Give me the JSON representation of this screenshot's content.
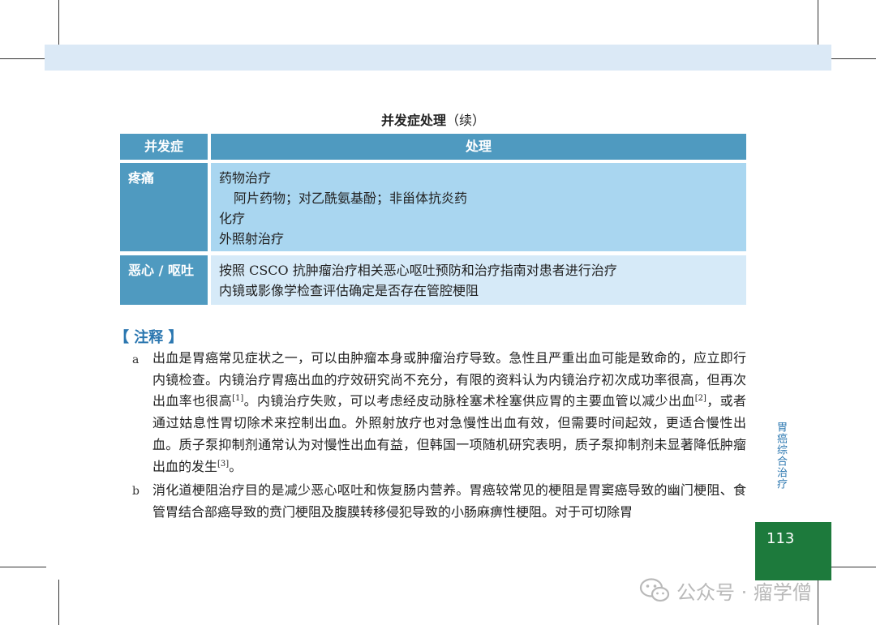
{
  "table": {
    "caption": "并发症处理",
    "caption_suffix": "（续）",
    "headers": {
      "complication": "并发症",
      "treatment": "处理"
    },
    "rows": [
      {
        "label": "疼痛",
        "lines": [
          "药物治疗",
          "阿片药物；对乙酰氨基酚；非甾体抗炎药",
          "化疗",
          "外照射治疗"
        ]
      },
      {
        "label": "恶心 / 呕吐",
        "lines": [
          "按照 CSCO 抗肿瘤治疗相关恶心呕吐预防和治疗指南对患者进行治疗",
          "内镜或影像学检查评估确定是否存在管腔梗阻"
        ]
      }
    ]
  },
  "notes": {
    "title": "【 注释 】",
    "a": {
      "marker": "a",
      "p1": "出血是胃癌常见症状之一，可以由肿瘤本身或肿瘤治疗导致。急性且严重出血可能是致命的，应立即行内镜检查。内镜治疗胃癌出血的疗效研究尚不充分，有限的资料认为内镜治疗初次成功率很高，但再次出血率也很高",
      "ref1": "[1]",
      "p2": "。内镜治疗失败，可以考虑经皮动脉栓塞术栓塞供应胃的主要血管以减少出血",
      "ref2": "[2]",
      "p3": "，或者通过姑息性胃切除术来控制出血。外照射放疗也对急慢性出血有效，但需要时间起效，更适合慢性出血。质子泵抑制剂通常认为对慢性出血有益，但韩国一项随机研究表明，质子泵抑制剂未显著降低肿瘤出血的发生",
      "ref3": "[3]",
      "p4": "。"
    },
    "b": {
      "marker": "b",
      "text": "消化道梗阻治疗目的是减少恶心呕吐和恢复肠内营养。胃癌较常见的梗阻是胃窦癌导致的幽门梗阻、食管胃结合部癌导致的贲门梗阻及腹膜转移侵犯导致的小肠麻痹性梗阻。对于可切除胃"
    }
  },
  "side_label": "胃癌综合治疗",
  "page_number": "113",
  "watermark": {
    "text": "公众号 · 瘤学僧",
    "icon": "wechat-icon"
  },
  "colors": {
    "header_band": "#dbe9f6",
    "table_header": "#4f9ac0",
    "row_pain": "#a9d6f0",
    "row_nausea": "#d6eaf8",
    "accent_blue": "#2b77b0",
    "page_box": "#1d7a3c"
  }
}
